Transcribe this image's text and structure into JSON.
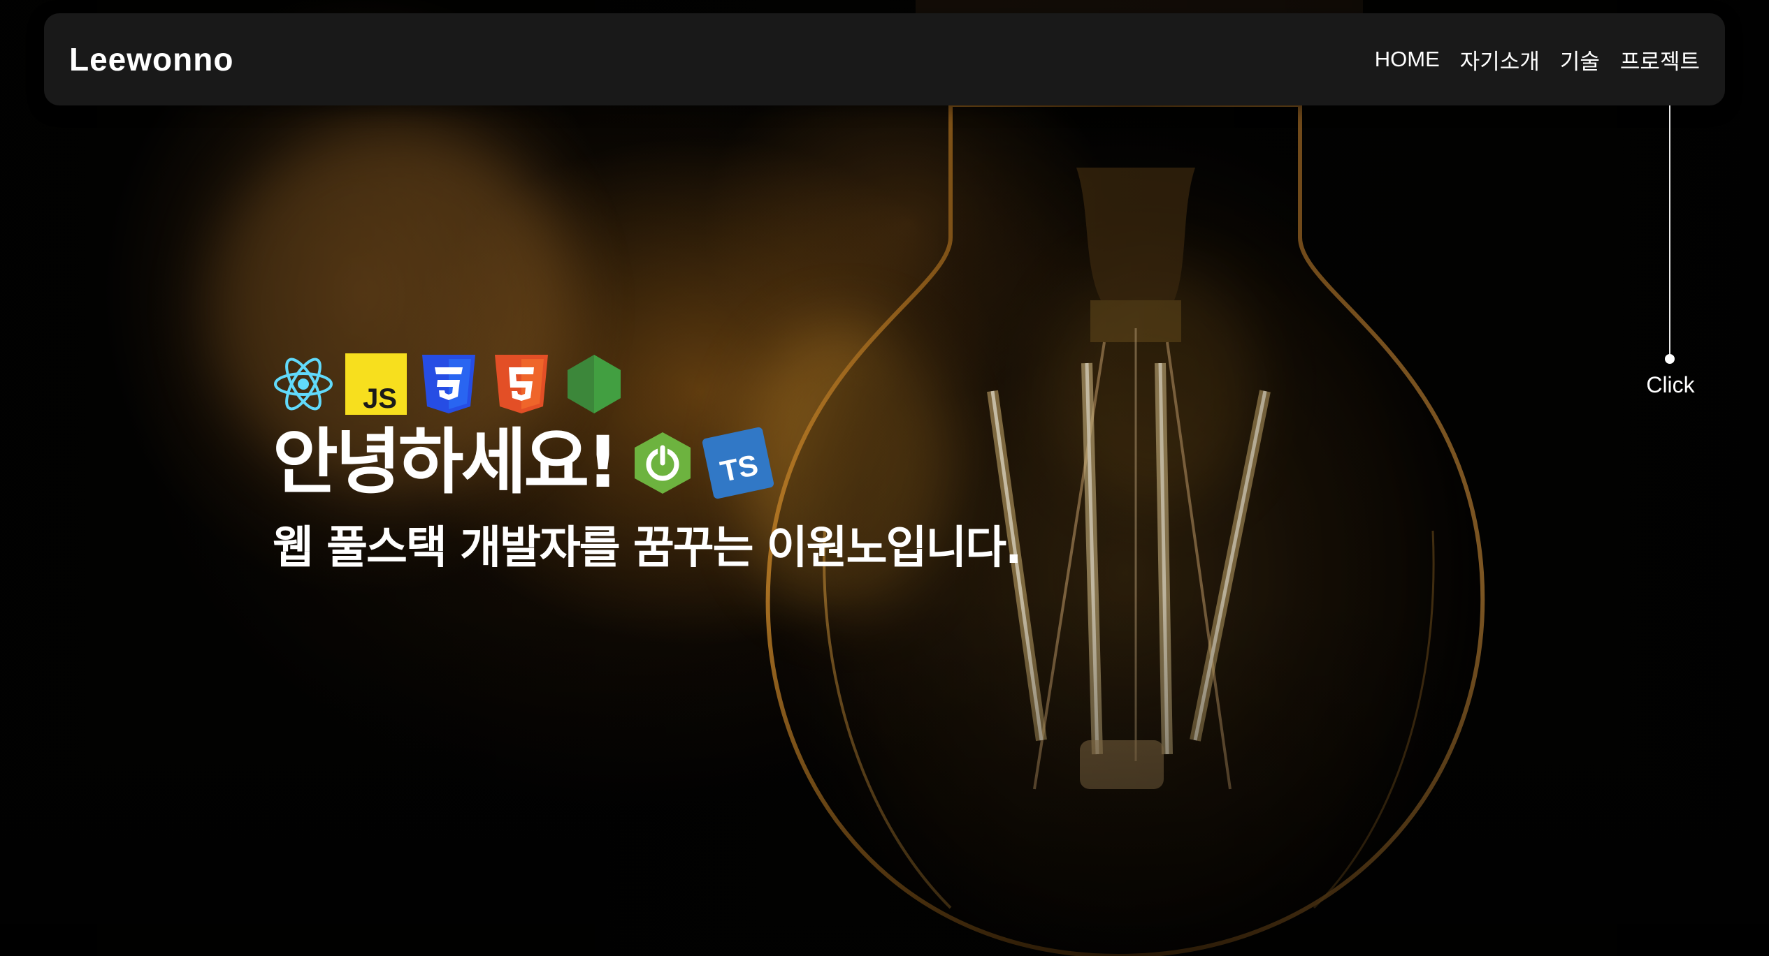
{
  "header": {
    "logo": "Leewonno",
    "nav": [
      {
        "label": "HOME"
      },
      {
        "label": "자기소개"
      },
      {
        "label": "기술"
      },
      {
        "label": "프로젝트"
      }
    ]
  },
  "scroll_hint": {
    "label": "Click"
  },
  "hero": {
    "tech_icons_top": [
      "react-icon",
      "javascript-icon",
      "css3-icon",
      "html5-icon",
      "nodejs-icon"
    ],
    "greeting": "안녕하세요!",
    "tech_icons_inline": [
      "spring-icon",
      "typescript-icon"
    ],
    "js_badge": "JS",
    "ts_badge": "TS",
    "subtitle": "웹 풀스택 개발자를 꿈꾸는 이원노입니다."
  },
  "colors": {
    "header_bg": "#191919",
    "text": "#ffffff",
    "react": "#61dafb",
    "javascript": "#f7df1e",
    "css3": "#264de4",
    "html5": "#e34f26",
    "nodejs": "#3c873a",
    "spring": "#6db33f",
    "typescript": "#3178c6"
  }
}
